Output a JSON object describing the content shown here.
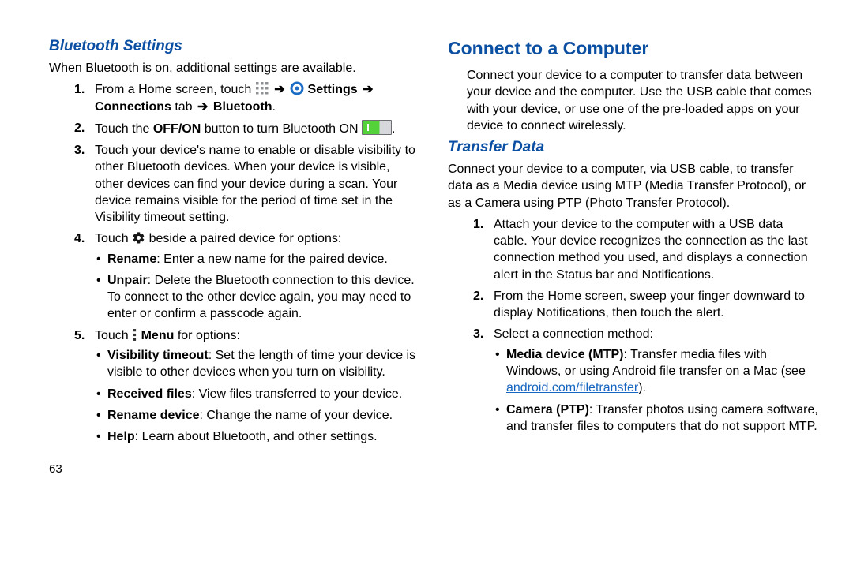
{
  "page_number": "63",
  "left": {
    "heading": "Bluetooth Settings",
    "intro": "When Bluetooth is on, additional settings are available.",
    "step1": {
      "lead": "From a Home screen, touch ",
      "arrow": "➔",
      "settings_word": "Settings",
      "conn_tab": "Connections",
      "tab_word": " tab ",
      "bt_word": "Bluetooth",
      "period": "."
    },
    "step2": {
      "lead": "Touch the ",
      "offon": "OFF/ON",
      "mid": " button to turn Bluetooth ON ",
      "period": "."
    },
    "step3": "Touch your device's name to enable or disable visibility to other Bluetooth devices. When your device is visible, other devices can find your device during a scan. Your device remains visible for the period of time set in the Visibility timeout setting.",
    "step4": {
      "lead": "Touch ",
      "tail": " beside a paired device for options:",
      "b1_label": "Rename",
      "b1_text": ": Enter a new name for the paired device.",
      "b2_label": "Unpair",
      "b2_text": ": Delete the Bluetooth connection to this device. To connect to the other device again, you may need to enter or confirm a passcode again."
    },
    "step5": {
      "lead": "Touch ",
      "menu_word": "Menu",
      "tail": " for options:",
      "b1_label": "Visibility timeout",
      "b1_text": ": Set the length of time your device is visible to other devices when you turn on visibility.",
      "b2_label": "Received files",
      "b2_text": ": View files transferred to your device.",
      "b3_label": "Rename device",
      "b3_text": ": Change the name of your device.",
      "b4_label": "Help",
      "b4_text": ": Learn about Bluetooth, and other settings."
    }
  },
  "right": {
    "heading": "Connect to a Computer",
    "intro": "Connect your device to a computer to transfer data between your device and the computer. Use the USB cable that comes with your device, or use one of the pre-loaded apps on your device to connect wirelessly.",
    "sub_heading": "Transfer Data",
    "sub_intro": "Connect your device to a computer, via USB cable, to transfer data as a Media device using MTP (Media Transfer Protocol), or as a Camera using PTP (Photo Transfer Protocol).",
    "step1": "Attach your device to the computer with a USB data cable. Your device recognizes the connection as the last connection method you used, and displays a connection alert in the Status bar and Notifications.",
    "step2": "From the Home screen, sweep your finger downward to display Notifications, then touch the alert.",
    "step3": {
      "lead": "Select a connection method:",
      "b1_label": "Media device (MTP)",
      "b1_pre": ": Transfer media files with Windows, or using Android file transfer on a Mac (see ",
      "b1_link": "android.com/filetransfer",
      "b1_post": ").",
      "b2_label": "Camera (PTP)",
      "b2_text": ": Transfer photos using camera software, and transfer files to computers that do not support MTP."
    }
  }
}
